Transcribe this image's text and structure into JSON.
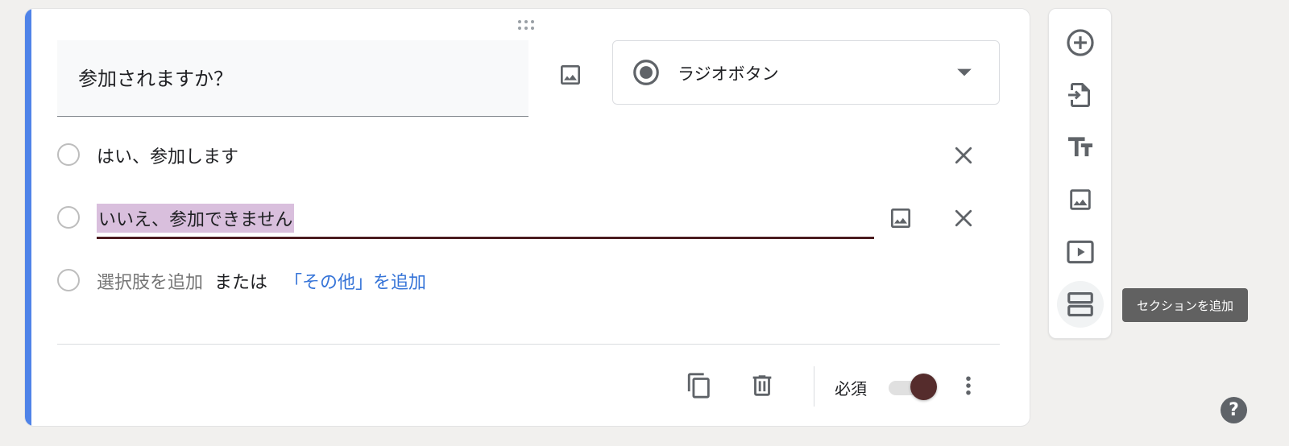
{
  "question": {
    "title": "参加されますか？"
  },
  "question_type": {
    "label": "ラジオボタン",
    "icon": "radio-button-icon"
  },
  "options": [
    {
      "label": "はい、参加します"
    },
    {
      "label": "いいえ、参加できません"
    }
  ],
  "add_option": {
    "add_label": "選択肢を追加",
    "or_label": "または",
    "other_label": "「その他」を追加"
  },
  "footer": {
    "required_label": "必須",
    "required": true
  },
  "toolbar": {
    "tooltip": "セクションを追加"
  },
  "help": {
    "label": "?"
  },
  "colors": {
    "accent": "#4f83e8",
    "toggle_on": "#552c2c",
    "selection": "#d9bfdd",
    "link": "#3674d8"
  }
}
